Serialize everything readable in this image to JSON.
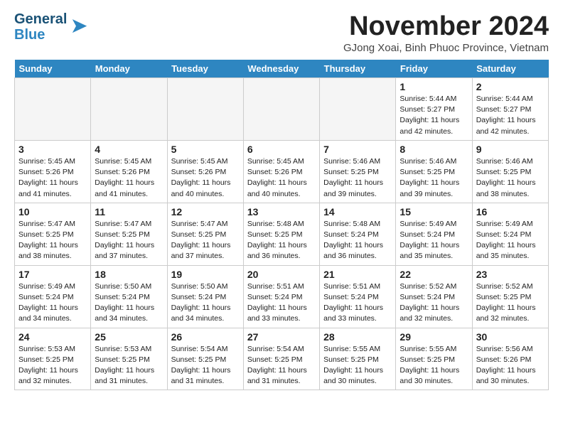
{
  "header": {
    "logo_line1": "General",
    "logo_line2": "Blue",
    "month": "November 2024",
    "location": "GJong Xoai, Binh Phuoc Province, Vietnam"
  },
  "days_of_week": [
    "Sunday",
    "Monday",
    "Tuesday",
    "Wednesday",
    "Thursday",
    "Friday",
    "Saturday"
  ],
  "weeks": [
    [
      {
        "day": "",
        "info": "",
        "empty": true
      },
      {
        "day": "",
        "info": "",
        "empty": true
      },
      {
        "day": "",
        "info": "",
        "empty": true
      },
      {
        "day": "",
        "info": "",
        "empty": true
      },
      {
        "day": "",
        "info": "",
        "empty": true
      },
      {
        "day": "1",
        "info": "Sunrise: 5:44 AM\nSunset: 5:27 PM\nDaylight: 11 hours\nand 42 minutes."
      },
      {
        "day": "2",
        "info": "Sunrise: 5:44 AM\nSunset: 5:27 PM\nDaylight: 11 hours\nand 42 minutes."
      }
    ],
    [
      {
        "day": "3",
        "info": "Sunrise: 5:45 AM\nSunset: 5:26 PM\nDaylight: 11 hours\nand 41 minutes."
      },
      {
        "day": "4",
        "info": "Sunrise: 5:45 AM\nSunset: 5:26 PM\nDaylight: 11 hours\nand 41 minutes."
      },
      {
        "day": "5",
        "info": "Sunrise: 5:45 AM\nSunset: 5:26 PM\nDaylight: 11 hours\nand 40 minutes."
      },
      {
        "day": "6",
        "info": "Sunrise: 5:45 AM\nSunset: 5:26 PM\nDaylight: 11 hours\nand 40 minutes."
      },
      {
        "day": "7",
        "info": "Sunrise: 5:46 AM\nSunset: 5:25 PM\nDaylight: 11 hours\nand 39 minutes."
      },
      {
        "day": "8",
        "info": "Sunrise: 5:46 AM\nSunset: 5:25 PM\nDaylight: 11 hours\nand 39 minutes."
      },
      {
        "day": "9",
        "info": "Sunrise: 5:46 AM\nSunset: 5:25 PM\nDaylight: 11 hours\nand 38 minutes."
      }
    ],
    [
      {
        "day": "10",
        "info": "Sunrise: 5:47 AM\nSunset: 5:25 PM\nDaylight: 11 hours\nand 38 minutes."
      },
      {
        "day": "11",
        "info": "Sunrise: 5:47 AM\nSunset: 5:25 PM\nDaylight: 11 hours\nand 37 minutes."
      },
      {
        "day": "12",
        "info": "Sunrise: 5:47 AM\nSunset: 5:25 PM\nDaylight: 11 hours\nand 37 minutes."
      },
      {
        "day": "13",
        "info": "Sunrise: 5:48 AM\nSunset: 5:25 PM\nDaylight: 11 hours\nand 36 minutes."
      },
      {
        "day": "14",
        "info": "Sunrise: 5:48 AM\nSunset: 5:24 PM\nDaylight: 11 hours\nand 36 minutes."
      },
      {
        "day": "15",
        "info": "Sunrise: 5:49 AM\nSunset: 5:24 PM\nDaylight: 11 hours\nand 35 minutes."
      },
      {
        "day": "16",
        "info": "Sunrise: 5:49 AM\nSunset: 5:24 PM\nDaylight: 11 hours\nand 35 minutes."
      }
    ],
    [
      {
        "day": "17",
        "info": "Sunrise: 5:49 AM\nSunset: 5:24 PM\nDaylight: 11 hours\nand 34 minutes."
      },
      {
        "day": "18",
        "info": "Sunrise: 5:50 AM\nSunset: 5:24 PM\nDaylight: 11 hours\nand 34 minutes."
      },
      {
        "day": "19",
        "info": "Sunrise: 5:50 AM\nSunset: 5:24 PM\nDaylight: 11 hours\nand 34 minutes."
      },
      {
        "day": "20",
        "info": "Sunrise: 5:51 AM\nSunset: 5:24 PM\nDaylight: 11 hours\nand 33 minutes."
      },
      {
        "day": "21",
        "info": "Sunrise: 5:51 AM\nSunset: 5:24 PM\nDaylight: 11 hours\nand 33 minutes."
      },
      {
        "day": "22",
        "info": "Sunrise: 5:52 AM\nSunset: 5:24 PM\nDaylight: 11 hours\nand 32 minutes."
      },
      {
        "day": "23",
        "info": "Sunrise: 5:52 AM\nSunset: 5:25 PM\nDaylight: 11 hours\nand 32 minutes."
      }
    ],
    [
      {
        "day": "24",
        "info": "Sunrise: 5:53 AM\nSunset: 5:25 PM\nDaylight: 11 hours\nand 32 minutes."
      },
      {
        "day": "25",
        "info": "Sunrise: 5:53 AM\nSunset: 5:25 PM\nDaylight: 11 hours\nand 31 minutes."
      },
      {
        "day": "26",
        "info": "Sunrise: 5:54 AM\nSunset: 5:25 PM\nDaylight: 11 hours\nand 31 minutes."
      },
      {
        "day": "27",
        "info": "Sunrise: 5:54 AM\nSunset: 5:25 PM\nDaylight: 11 hours\nand 31 minutes."
      },
      {
        "day": "28",
        "info": "Sunrise: 5:55 AM\nSunset: 5:25 PM\nDaylight: 11 hours\nand 30 minutes."
      },
      {
        "day": "29",
        "info": "Sunrise: 5:55 AM\nSunset: 5:25 PM\nDaylight: 11 hours\nand 30 minutes."
      },
      {
        "day": "30",
        "info": "Sunrise: 5:56 AM\nSunset: 5:26 PM\nDaylight: 11 hours\nand 30 minutes."
      }
    ]
  ]
}
